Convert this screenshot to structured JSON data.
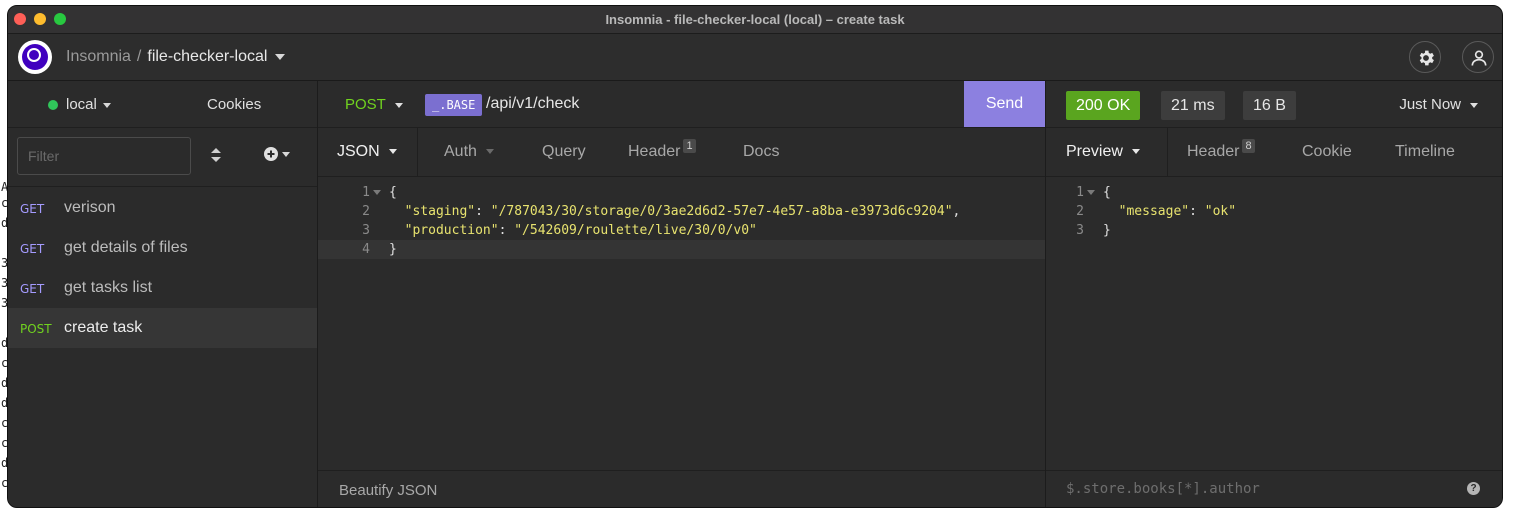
{
  "window": {
    "title": "Insomnia - file-checker-local (local) – create task"
  },
  "header": {
    "workspace": "Insomnia",
    "separator": "/",
    "project": "file-checker-local"
  },
  "icons": {
    "settings": "gear-icon",
    "account": "user-icon",
    "sort": "sort-arrows-icon",
    "add": "plus-circle-icon",
    "help": "question-icon"
  },
  "sidebar": {
    "environment": "local",
    "cookies_label": "Cookies",
    "filter_placeholder": "Filter",
    "requests": [
      {
        "method": "GET",
        "name": "verison"
      },
      {
        "method": "GET",
        "name": "get details of files"
      },
      {
        "method": "GET",
        "name": "get tasks list"
      },
      {
        "method": "POST",
        "name": "create task"
      }
    ]
  },
  "request": {
    "method": "POST",
    "base_tag": "_.BASE",
    "url_path": "/api/v1/check",
    "send_label": "Send",
    "tabs": [
      {
        "label": "JSON"
      },
      {
        "label": "Auth"
      },
      {
        "label": "Query"
      },
      {
        "label": "Header",
        "count": "1"
      },
      {
        "label": "Docs"
      }
    ],
    "body": {
      "open": "{",
      "close": "}",
      "lines": [
        {
          "key": "\"staging\"",
          "value": "\"/787043/30/storage/0/3ae2d6d2-57e7-4e57-a8ba-e3973d6c9204\"",
          "trail": ","
        },
        {
          "key": "\"production\"",
          "value": "\"/542609/roulette/live/30/0/v0\"",
          "trail": ""
        }
      ],
      "line_numbers": [
        "1",
        "2",
        "3",
        "4"
      ]
    },
    "footer_label": "Beautify JSON"
  },
  "response": {
    "status": "200 OK",
    "time": "21 ms",
    "size": "16 B",
    "when": "Just Now",
    "tabs": [
      {
        "label": "Preview"
      },
      {
        "label": "Header",
        "count": "8"
      },
      {
        "label": "Cookie"
      },
      {
        "label": "Timeline"
      }
    ],
    "body": {
      "open": "{",
      "close": "}",
      "key": "\"message\"",
      "value": "\"ok\"",
      "line_numbers": [
        "1",
        "2",
        "3"
      ]
    },
    "filter_placeholder": "$.store.books[*].author"
  },
  "background_text": [
    "A",
    "c",
    "d",
    "3",
    "3",
    "3",
    "d",
    "c",
    "d",
    "d",
    "c",
    "c",
    "d",
    "c",
    "c"
  ]
}
